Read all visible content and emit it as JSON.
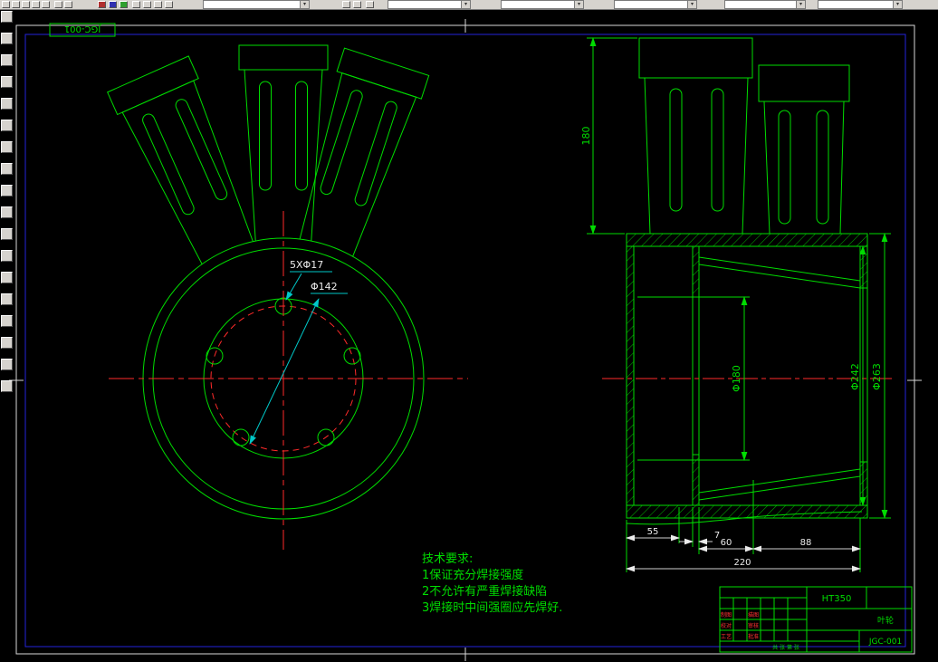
{
  "toolbar": {
    "dropdown_arrow": "▾"
  },
  "frame": {
    "label": "JGC-001"
  },
  "front_view": {
    "dim_holes": "5XΦ17",
    "dim_bolt_circle": "Φ142"
  },
  "side_view": {
    "dim_blade_height": "180",
    "dim_bore": "Φ180",
    "dim_inner_diameter": "Φ242",
    "dim_outer_diameter": "Φ263",
    "dim_width_55": "55",
    "dim_width_7": "7",
    "dim_width_60": "60",
    "dim_width_88": "88",
    "dim_total_220": "220"
  },
  "notes": {
    "title": "技术要求:",
    "line1": "1保证充分焊接强度",
    "line2": "2不允许有严重焊接缺陷",
    "line3": "3焊接时中间强圈应先焊好."
  },
  "title_block": {
    "material": "HT350",
    "drawing_no": "JGC-001",
    "part_name": "叶轮",
    "label_drafter": "制图",
    "label_tracer": "描图",
    "label_checker": "校对",
    "label_auditor": "审核",
    "label_process": "工艺",
    "label_approver": "批准",
    "footer": "共 张 第 张"
  }
}
